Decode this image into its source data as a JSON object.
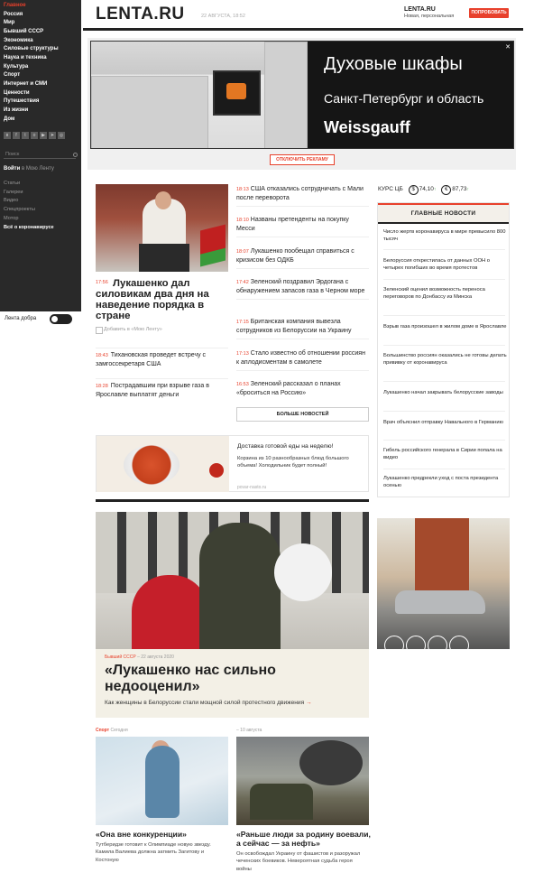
{
  "sidebar": {
    "nav": [
      "Главное",
      "Россия",
      "Мир",
      "Бывший СССР",
      "Экономика",
      "Силовые структуры",
      "Наука и техника",
      "Культура",
      "Спорт",
      "Интернет и СМИ",
      "Ценности",
      "Путешествия",
      "Из жизни",
      "Дом"
    ],
    "search_placeholder": "Поиск",
    "login": "Войти",
    "login_suffix": "в Мою Ленту",
    "links": [
      "Статьи",
      "Галереи",
      "Видео",
      "Спецпроекты",
      "Мотор"
    ],
    "links_bold": "Всё о коронавирусе",
    "theme_label": "Лента добра"
  },
  "header": {
    "logo": "LENTA.RU",
    "date": "22 АВГУСТА, 18:52",
    "brand": "LENTA.RU",
    "brand_sub": "Новая, персональная",
    "try_button": "ПОПРОБОВАТЬ"
  },
  "ad": {
    "line1": "Духовые шкафы",
    "line2": "Санкт-Петербург и область",
    "line3": "Weissgauff",
    "close": "✕",
    "disable_button": "ОТКЛЮЧИТЬ РЕКЛАМУ"
  },
  "lead": {
    "time": "17:56",
    "title": "Лукашенко дал силовикам два дня на наведение порядка в стране",
    "add_label": "Добавить в «Мою Ленту»"
  },
  "left_news": [
    {
      "time": "18:43",
      "text": "Тихановская проведет встречу с замгоссекретаря США"
    },
    {
      "time": "18:28",
      "text": "Пострадавшим при взрыве газа в Ярославле выплатят деньги"
    }
  ],
  "news": [
    {
      "time": "18:13",
      "text": "США отказались сотрудничать с Мали после переворота"
    },
    {
      "time": "18:10",
      "text": "Названы претенденты на покупку Месси"
    },
    {
      "time": "18:07",
      "text": "Лукашенко пообещал справиться с кризисом без ОДКБ"
    },
    {
      "time": "17:42",
      "text": "Зеленский поздравил Эрдогана с обнаружением запасов газа в Черном море"
    },
    {
      "time": "17:15",
      "text": "Британская компания вывезла сотрудников из Белоруссии на Украину"
    },
    {
      "time": "17:13",
      "text": "Стало известно об отношении россиян к аплодисментам в самолете"
    },
    {
      "time": "16:53",
      "text": "Зеленский рассказал о планах «броситься на Россию»"
    }
  ],
  "more_button": "БОЛЬШЕ НОВОСТЕЙ",
  "rates": {
    "label": "КУРС ЦБ",
    "usd_symbol": "$",
    "usd": "74,10",
    "eur_symbol": "€",
    "eur": "87,73",
    "arrow": "↑"
  },
  "main_news": {
    "title": "ГЛАВНЫЕ НОВОСТИ",
    "items": [
      "Число жертв коронавируса в мире превысило 800 тысяч",
      "Белоруссия открестилась от данных ООН о четырех погибших во время протестов",
      "Зеленский оценил возможность переноса переговоров по Донбассу из Минска",
      "Взрыв газа произошел в жилом доме в Ярославле",
      "Большинство россиян оказались не готовы делать прививку от коронавируса",
      "Лукашенко начал закрывать белорусские заводы",
      "Врач объяснил отправку Навального в Германию",
      "Гибель российского генерала в Сирии попала на видео",
      "Лукашенко предрекли уход с поста президента осенью"
    ]
  },
  "delivery": {
    "title": "Доставка готовой еды на неделю!",
    "text": "Корзина из 10 разнообразных блюд большого объема! Холодильник будет полный!",
    "source": "povar-nasto.ru"
  },
  "big_story": {
    "category": "Бывший СССР",
    "date": "– 22 августа 2020",
    "title": "«Лукашенко нас сильно недооценил»",
    "subtitle": "Как женщины в Белоруссии стали мощной силой протестного движения",
    "arrow": "→"
  },
  "cards": [
    {
      "category": "Спорт",
      "date": "Сегодня",
      "title": "«Она вне конкуренции»",
      "text": "Тутберидзе готовит к Олимпиаде новую звезду. Камила Валиева должна затмить Загитову и Костоную"
    },
    {
      "category": "",
      "date": "– 10 августа",
      "title": "«Раньше люди за родину воевали, а сейчас — за нефть»",
      "text": "Он освобождал Украину от фашистов и разоружал чеченских боевиков. Невероятная судьба героя войны"
    }
  ]
}
